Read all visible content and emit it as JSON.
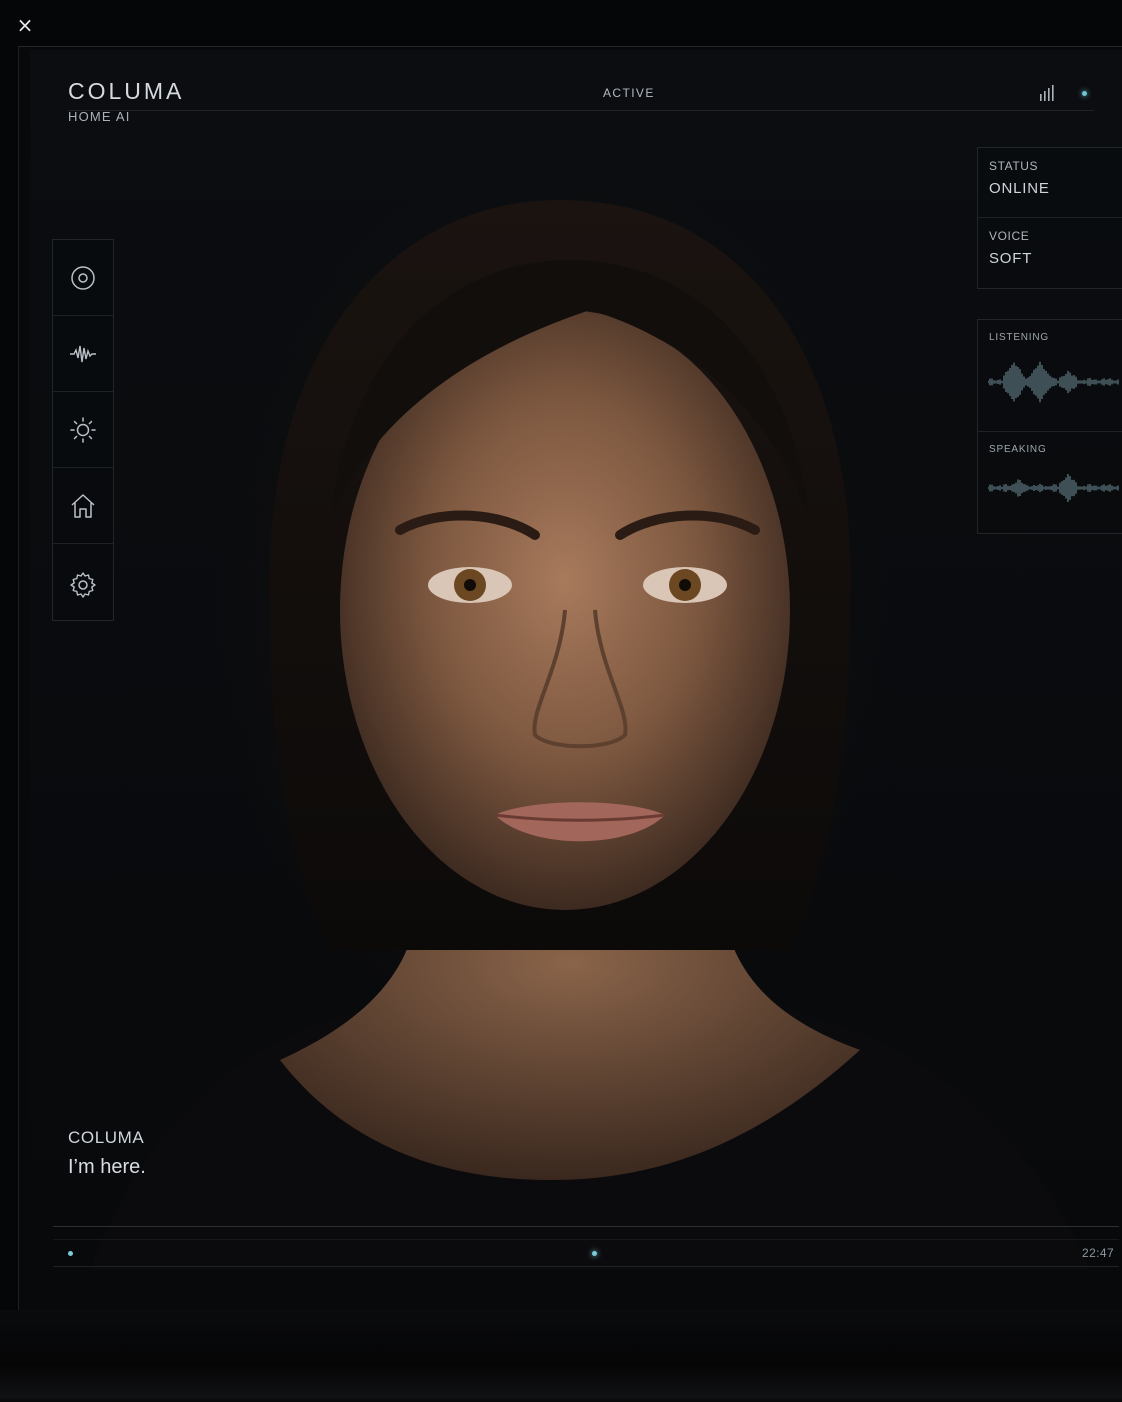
{
  "app": {
    "name": "COLUMA",
    "subtitle": "HOME AI",
    "status": "ACTIVE",
    "close_label": "×"
  },
  "sidebar": {
    "items": [
      {
        "icon": "target-icon",
        "label": "focus"
      },
      {
        "icon": "waveform-icon",
        "label": "voice"
      },
      {
        "icon": "sun-icon",
        "label": "light"
      },
      {
        "icon": "home-icon",
        "label": "home"
      },
      {
        "icon": "gear-icon",
        "label": "settings"
      }
    ]
  },
  "info_panel": {
    "status_label": "STATUS",
    "status_value": "ONLINE",
    "voice_label": "VOICE",
    "voice_value": "SOFT"
  },
  "audio_panel": {
    "listening_label": "LISTENING",
    "speaking_label": "SPEAKING"
  },
  "caption": {
    "speaker": "COLUMA",
    "text": "I’m here."
  },
  "footer": {
    "time": "22:47"
  },
  "colors": {
    "accent": "#6fc6d2",
    "text": "#c9d0d6",
    "background": "#07090b"
  }
}
